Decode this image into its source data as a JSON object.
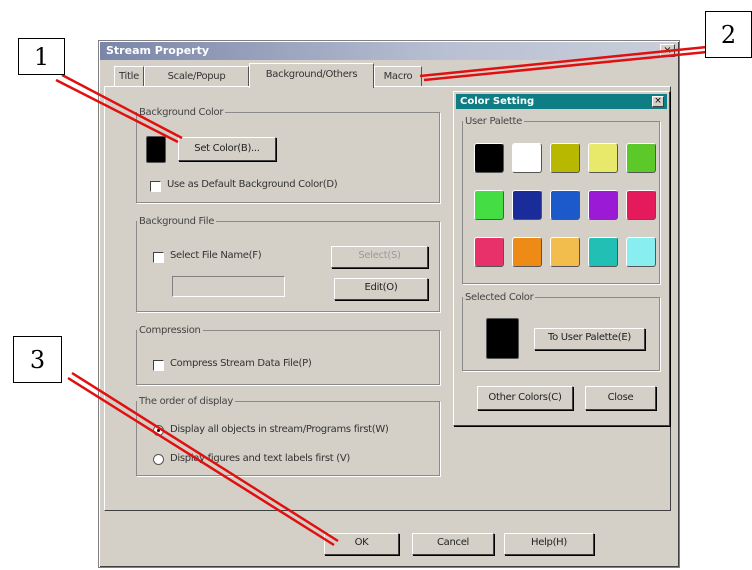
{
  "window": {
    "title": "Stream Property",
    "close_glyph": "×"
  },
  "tabs": [
    {
      "label": "Title"
    },
    {
      "label": "Scale/Popup"
    },
    {
      "label": "Background/Others"
    },
    {
      "label": "Macro"
    }
  ],
  "background_color": {
    "legend": "Background Color",
    "swatch_color": "#000000",
    "set_color_button": "Set Color(B)...",
    "use_default_label": "Use as Default Background Color(D)"
  },
  "background_file": {
    "legend": "Background File",
    "select_file_label": "Select File Name(F)",
    "select_button": "Select(S)",
    "edit_button": "Edit(O)",
    "file_value": ""
  },
  "compression": {
    "legend": "Compression",
    "compress_label": "Compress Stream Data File(P)"
  },
  "display_order": {
    "legend": "The order of display",
    "option1": "Display all objects in stream/Programs first(W)",
    "option2": "Display figures and text labels first (V)"
  },
  "footer": {
    "ok": "OK",
    "cancel": "Cancel",
    "help": "Help(H)"
  },
  "color_setting": {
    "title": "Color Setting",
    "close_glyph": "×",
    "user_palette_legend": "User Palette",
    "palette": [
      "#000000",
      "#ffffff",
      "#b8b800",
      "#e8e86a",
      "#5cc82a",
      "#44dd44",
      "#1a2c9a",
      "#1c5acc",
      "#9b1ad6",
      "#e41a5c",
      "#e8306a",
      "#ee8a16",
      "#f2bd4c",
      "#22c0b4",
      "#88eef0"
    ],
    "selected_legend": "Selected Color",
    "selected_color": "#000000",
    "to_user_palette_button": "To User Palette(E)",
    "other_colors_button": "Other Colors(C)",
    "close_button": "Close"
  },
  "callouts": {
    "c1": "1",
    "c2": "2",
    "c3": "3"
  },
  "annotation_color": "#e01010"
}
